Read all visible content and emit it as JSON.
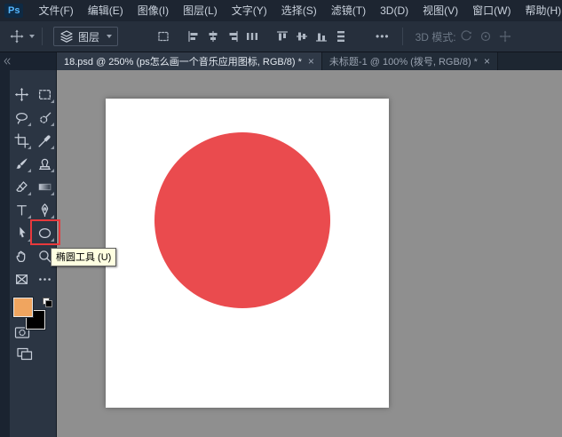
{
  "window": {
    "logo": "Ps"
  },
  "menubar": {
    "items": [
      "文件(F)",
      "编辑(E)",
      "图像(I)",
      "图层(L)",
      "文字(Y)",
      "选择(S)",
      "滤镜(T)",
      "3D(D)",
      "视图(V)",
      "窗口(W)",
      "帮助(H)"
    ]
  },
  "options_bar": {
    "layers_label": "图层",
    "more": "•••",
    "mode_label": "3D 模式:",
    "icons": [
      "move-tool-preset-icon",
      "layers-stack-icon",
      "transform-controls-icon",
      "align-left-icon",
      "align-center-horizontal-icon",
      "align-right-icon",
      "distribute-horizontal-icon",
      "align-top-icon",
      "align-middle-vertical-icon",
      "align-bottom-icon",
      "distribute-vertical-icon",
      "more-options-icon",
      "3d-orbit-icon",
      "3d-roll-icon",
      "3d-pan-icon"
    ]
  },
  "tabs": [
    {
      "label": "18.psd @ 250% (ps怎么画一个音乐应用图标, RGB/8) *",
      "close": "×"
    },
    {
      "label": "未标题-1 @ 100% (拨号, RGB/8) *",
      "close": "×"
    }
  ],
  "tools": {
    "items": [
      "move",
      "rectangular-marquee",
      "lasso",
      "quick-selection",
      "crop",
      "eyedropper",
      "brush",
      "clone-stamp",
      "eraser",
      "gradient",
      "type",
      "pen",
      "path-selection",
      "ellipse",
      "hand",
      "zoom",
      "slice",
      "edit-toolbar-more"
    ],
    "selected_tool": "ellipse",
    "header_icon": "collapse-double-chevron-icon"
  },
  "swatches": {
    "foreground": "#f0a55f",
    "background": "#000000"
  },
  "tooltip": {
    "text": "椭圆工具 (U)"
  },
  "canvas": {
    "workspace_background": "#8f8f8f",
    "document": {
      "background": "#ffffff",
      "shape": "circle",
      "shape_color": "#ea4b4e"
    }
  },
  "colors": {
    "highlight_red": "#e8393c",
    "tooltip_bg": "#ffffe1"
  }
}
